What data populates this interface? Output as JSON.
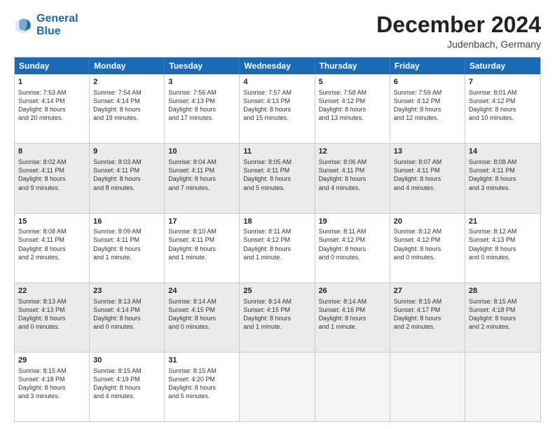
{
  "logo": {
    "line1": "General",
    "line2": "Blue"
  },
  "title": {
    "month_year": "December 2024",
    "location": "Judenbach, Germany"
  },
  "weekdays": [
    "Sunday",
    "Monday",
    "Tuesday",
    "Wednesday",
    "Thursday",
    "Friday",
    "Saturday"
  ],
  "weeks": [
    [
      {
        "day": "1",
        "lines": [
          "Sunrise: 7:53 AM",
          "Sunset: 4:14 PM",
          "Daylight: 8 hours",
          "and 20 minutes."
        ]
      },
      {
        "day": "2",
        "lines": [
          "Sunrise: 7:54 AM",
          "Sunset: 4:14 PM",
          "Daylight: 8 hours",
          "and 19 minutes."
        ]
      },
      {
        "day": "3",
        "lines": [
          "Sunrise: 7:56 AM",
          "Sunset: 4:13 PM",
          "Daylight: 8 hours",
          "and 17 minutes."
        ]
      },
      {
        "day": "4",
        "lines": [
          "Sunrise: 7:57 AM",
          "Sunset: 4:13 PM",
          "Daylight: 8 hours",
          "and 15 minutes."
        ]
      },
      {
        "day": "5",
        "lines": [
          "Sunrise: 7:58 AM",
          "Sunset: 4:12 PM",
          "Daylight: 8 hours",
          "and 13 minutes."
        ]
      },
      {
        "day": "6",
        "lines": [
          "Sunrise: 7:59 AM",
          "Sunset: 4:12 PM",
          "Daylight: 8 hours",
          "and 12 minutes."
        ]
      },
      {
        "day": "7",
        "lines": [
          "Sunrise: 8:01 AM",
          "Sunset: 4:12 PM",
          "Daylight: 8 hours",
          "and 10 minutes."
        ]
      }
    ],
    [
      {
        "day": "8",
        "lines": [
          "Sunrise: 8:02 AM",
          "Sunset: 4:11 PM",
          "Daylight: 8 hours",
          "and 9 minutes."
        ]
      },
      {
        "day": "9",
        "lines": [
          "Sunrise: 8:03 AM",
          "Sunset: 4:11 PM",
          "Daylight: 8 hours",
          "and 8 minutes."
        ]
      },
      {
        "day": "10",
        "lines": [
          "Sunrise: 8:04 AM",
          "Sunset: 4:11 PM",
          "Daylight: 8 hours",
          "and 7 minutes."
        ]
      },
      {
        "day": "11",
        "lines": [
          "Sunrise: 8:05 AM",
          "Sunset: 4:11 PM",
          "Daylight: 8 hours",
          "and 5 minutes."
        ]
      },
      {
        "day": "12",
        "lines": [
          "Sunrise: 8:06 AM",
          "Sunset: 4:11 PM",
          "Daylight: 8 hours",
          "and 4 minutes."
        ]
      },
      {
        "day": "13",
        "lines": [
          "Sunrise: 8:07 AM",
          "Sunset: 4:11 PM",
          "Daylight: 8 hours",
          "and 4 minutes."
        ]
      },
      {
        "day": "14",
        "lines": [
          "Sunrise: 8:08 AM",
          "Sunset: 4:11 PM",
          "Daylight: 8 hours",
          "and 3 minutes."
        ]
      }
    ],
    [
      {
        "day": "15",
        "lines": [
          "Sunrise: 8:08 AM",
          "Sunset: 4:11 PM",
          "Daylight: 8 hours",
          "and 2 minutes."
        ]
      },
      {
        "day": "16",
        "lines": [
          "Sunrise: 8:09 AM",
          "Sunset: 4:11 PM",
          "Daylight: 8 hours",
          "and 1 minute."
        ]
      },
      {
        "day": "17",
        "lines": [
          "Sunrise: 8:10 AM",
          "Sunset: 4:11 PM",
          "Daylight: 8 hours",
          "and 1 minute."
        ]
      },
      {
        "day": "18",
        "lines": [
          "Sunrise: 8:11 AM",
          "Sunset: 4:12 PM",
          "Daylight: 8 hours",
          "and 1 minute."
        ]
      },
      {
        "day": "19",
        "lines": [
          "Sunrise: 8:11 AM",
          "Sunset: 4:12 PM",
          "Daylight: 8 hours",
          "and 0 minutes."
        ]
      },
      {
        "day": "20",
        "lines": [
          "Sunrise: 8:12 AM",
          "Sunset: 4:12 PM",
          "Daylight: 8 hours",
          "and 0 minutes."
        ]
      },
      {
        "day": "21",
        "lines": [
          "Sunrise: 8:12 AM",
          "Sunset: 4:13 PM",
          "Daylight: 8 hours",
          "and 0 minutes."
        ]
      }
    ],
    [
      {
        "day": "22",
        "lines": [
          "Sunrise: 8:13 AM",
          "Sunset: 4:13 PM",
          "Daylight: 8 hours",
          "and 0 minutes."
        ]
      },
      {
        "day": "23",
        "lines": [
          "Sunrise: 8:13 AM",
          "Sunset: 4:14 PM",
          "Daylight: 8 hours",
          "and 0 minutes."
        ]
      },
      {
        "day": "24",
        "lines": [
          "Sunrise: 8:14 AM",
          "Sunset: 4:15 PM",
          "Daylight: 8 hours",
          "and 0 minutes."
        ]
      },
      {
        "day": "25",
        "lines": [
          "Sunrise: 8:14 AM",
          "Sunset: 4:15 PM",
          "Daylight: 8 hours",
          "and 1 minute."
        ]
      },
      {
        "day": "26",
        "lines": [
          "Sunrise: 8:14 AM",
          "Sunset: 4:16 PM",
          "Daylight: 8 hours",
          "and 1 minute."
        ]
      },
      {
        "day": "27",
        "lines": [
          "Sunrise: 8:15 AM",
          "Sunset: 4:17 PM",
          "Daylight: 8 hours",
          "and 2 minutes."
        ]
      },
      {
        "day": "28",
        "lines": [
          "Sunrise: 8:15 AM",
          "Sunset: 4:18 PM",
          "Daylight: 8 hours",
          "and 2 minutes."
        ]
      }
    ],
    [
      {
        "day": "29",
        "lines": [
          "Sunrise: 8:15 AM",
          "Sunset: 4:18 PM",
          "Daylight: 8 hours",
          "and 3 minutes."
        ]
      },
      {
        "day": "30",
        "lines": [
          "Sunrise: 8:15 AM",
          "Sunset: 4:19 PM",
          "Daylight: 8 hours",
          "and 4 minutes."
        ]
      },
      {
        "day": "31",
        "lines": [
          "Sunrise: 8:15 AM",
          "Sunset: 4:20 PM",
          "Daylight: 8 hours",
          "and 5 minutes."
        ]
      },
      {
        "day": "",
        "lines": [],
        "empty": true
      },
      {
        "day": "",
        "lines": [],
        "empty": true
      },
      {
        "day": "",
        "lines": [],
        "empty": true
      },
      {
        "day": "",
        "lines": [],
        "empty": true
      }
    ]
  ]
}
